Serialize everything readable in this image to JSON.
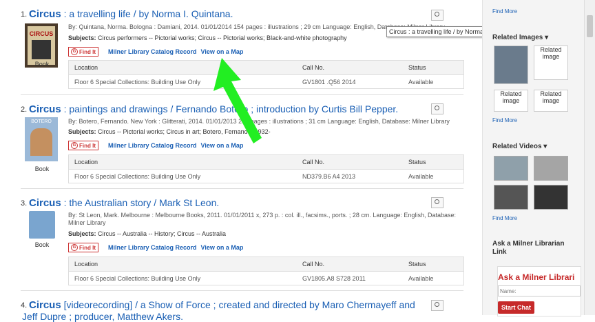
{
  "results": [
    {
      "num": "1.",
      "title_bold": "Circus",
      "title_rest": " : a travelling life / by Norma I. Quintana.",
      "byline": "By: Quintana, Norma. Bologna : Damiani, 2014. 01/01/2014 154 pages : illustrations ; 29 cm Language: English, Database: Milner Library",
      "subjects_label": "Subjects:",
      "subjects": "Circus performers -- Pictorial works; Circus -- Pictorial works; Black-and-white photography",
      "format": "Book",
      "findit": "Find It",
      "catalog_link": "Milner Library Catalog Record",
      "map_link": "View on a Map",
      "holdings": {
        "location_hdr": "Location",
        "call_hdr": "Call No.",
        "status_hdr": "Status",
        "location": "Floor 6 Special Collections: Building Use Only",
        "call": "GV1801 .Q56 2014",
        "status": "Available"
      }
    },
    {
      "num": "2.",
      "title_bold": "Circus",
      "title_rest": " : paintings and drawings / Fernando Botero ; introduction by Curtis Bill Pepper.",
      "byline": "By: Botero, Fernando. New York : Glitterati, 2014. 01/01/2013 253 pages : illustrations ; 31 cm Language: English, Database: Milner Library",
      "subjects_label": "Subjects:",
      "subjects": "Circus -- Pictorial works; Circus in art; Botero, Fernando, 1932-",
      "format": "Book",
      "findit": "Find It",
      "catalog_link": "Milner Library Catalog Record",
      "map_link": "View on a Map",
      "holdings": {
        "location_hdr": "Location",
        "call_hdr": "Call No.",
        "status_hdr": "Status",
        "location": "Floor 6 Special Collections: Building Use Only",
        "call": "ND379.B6 A4 2013",
        "status": "Available"
      }
    },
    {
      "num": "3.",
      "title_bold": "Circus",
      "title_rest": " : the Australian story / Mark St Leon.",
      "byline": "By: St Leon, Mark. Melbourne : Melbourne Books, 2011. 01/01/2011 x, 273 p. : col. ill., facsims., ports. ; 28 cm. Language: English, Database: Milner Library",
      "subjects_label": "Subjects:",
      "subjects": "Circus -- Australia -- History; Circus -- Australia",
      "format": "Book",
      "findit": "Find It",
      "catalog_link": "Milner Library Catalog Record",
      "map_link": "View on a Map",
      "holdings": {
        "location_hdr": "Location",
        "call_hdr": "Call No.",
        "status_hdr": "Status",
        "location": "Floor 6 Special Collections: Building Use Only",
        "call": "GV1805.A8 S728 2011",
        "status": "Available"
      }
    },
    {
      "num": "4.",
      "title_bold": "Circus",
      "title_rest": " [videorecording] / a Show of Force ; created and directed by Maro Chermayeff and",
      "title_line2": "Jeff Dupre ; producer, Matthew Akers."
    }
  ],
  "tooltip": "Circus : a travelling life / by Norma I. Quintana.",
  "sidebar": {
    "find_more": "Find More",
    "related_images": "Related Images",
    "related_image_alt": "Related image",
    "related_videos": "Related Videos",
    "ask_link": "Ask a Milner Librarian Link",
    "chat_title": "Ask a Milner Librari",
    "chat_name_placeholder": "Name:",
    "start_chat": "Start Chat"
  },
  "cover_label_botero": "BOTERO",
  "cover_label_circus": "CIRCUS",
  "colors": {
    "link": "#1a5fb4",
    "arrow": "#22ee22",
    "findit": "#cc3333",
    "chat_red": "#c62a2a"
  }
}
